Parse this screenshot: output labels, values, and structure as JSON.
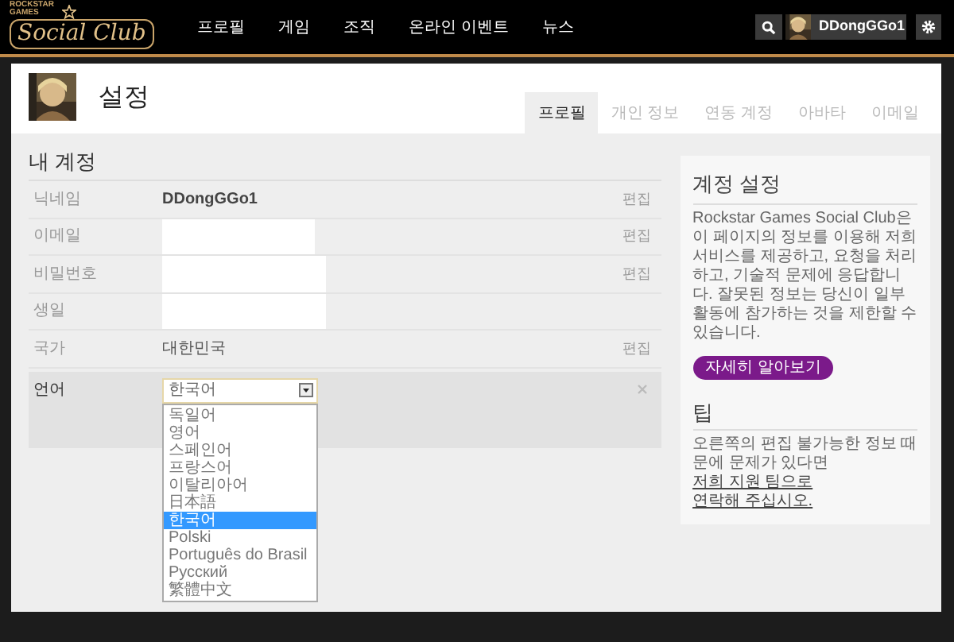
{
  "logo": {
    "small": "ROCKSTAR GAMES",
    "main": "Social Club"
  },
  "nav": [
    {
      "label": "프로필"
    },
    {
      "label": "게임"
    },
    {
      "label": "조직"
    },
    {
      "label": "온라인 이벤트"
    },
    {
      "label": "뉴스"
    }
  ],
  "user": {
    "name": "DDongGGo1"
  },
  "page": {
    "title": "설정"
  },
  "tabs": [
    {
      "label": "프로필",
      "selected": true
    },
    {
      "label": "개인 정보",
      "selected": false
    },
    {
      "label": "연동 계정",
      "selected": false
    },
    {
      "label": "아바타",
      "selected": false
    },
    {
      "label": "이메일",
      "selected": false
    }
  ],
  "account": {
    "heading": "내 계정",
    "rows": [
      {
        "kind": "text",
        "label": "닉네임",
        "value": "DDongGGo1",
        "action": "편집"
      },
      {
        "kind": "redacted",
        "label": "이메일",
        "action": "편집"
      },
      {
        "kind": "redacted",
        "label": "비밀번호",
        "action": "편집"
      },
      {
        "kind": "redacted",
        "label": "생일"
      },
      {
        "kind": "plain",
        "label": "국가",
        "value": "대한민국",
        "action": "편집"
      },
      {
        "kind": "select",
        "label": "언어",
        "value": "한국어",
        "expanded": true,
        "options": [
          {
            "label": "독일어",
            "selected": false
          },
          {
            "label": "영어",
            "selected": false
          },
          {
            "label": "스페인어",
            "selected": false
          },
          {
            "label": "프랑스어",
            "selected": false
          },
          {
            "label": "이탈리아어",
            "selected": false
          },
          {
            "label": "日本語",
            "selected": false
          },
          {
            "label": "한국어",
            "selected": true
          },
          {
            "label": "Polski",
            "selected": false
          },
          {
            "label": "Português do Brasil",
            "selected": false
          },
          {
            "label": "Русский",
            "selected": false
          },
          {
            "label": "繁體中文",
            "selected": false
          }
        ]
      }
    ]
  },
  "sidebar": {
    "heading": "계정 설정",
    "text": "Rockstar Games Social Club은 이 페이지의 정보를 이용해 저희 서비스를 제공하고, 요청을 처리하고, 기술적 문제에 응답합니다. 잘못된 정보는 당신이 일부 활동에 참가하는 것을 제한할 수 있습니다.",
    "button": "자세히 알아보기",
    "tip_heading": "팁",
    "tip_text": "오른쪽의 편집 불가능한 정보 때문에 문제가 있다면",
    "tip_link_lines": [
      "저희 지원 팀으로",
      "연락해 주십시오."
    ]
  }
}
